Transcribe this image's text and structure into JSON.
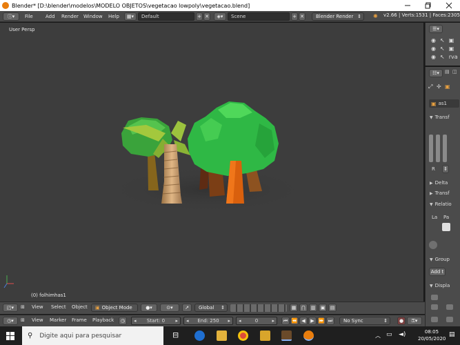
{
  "window": {
    "title": "Blender* [D:\\blender\\modelos\\MODELO OBJETOS\\vegetacao lowpoly\\vegetacao.blend]",
    "minimize_icon": "minimize-icon",
    "maximize_icon": "maximize-icon",
    "close_icon": "close-icon"
  },
  "info_header": {
    "menus": [
      "File",
      "Add",
      "Render",
      "Window",
      "Help"
    ],
    "screen_layout": "Default",
    "scene": "Scene",
    "render_engine": "Blender Render",
    "stats": "v2.66 | Verts:1531 | Faces:2305"
  },
  "viewport": {
    "view_label": "User Persp",
    "object_label": "(0) folhimhas1"
  },
  "outliner": {
    "partial_label": "rva"
  },
  "properties": {
    "object_field": "as1",
    "panels": [
      "Transf",
      "Delta",
      "Transf",
      "Relatio",
      "Group",
      "Displa"
    ],
    "relations_labels": [
      "La",
      "Pa"
    ],
    "r_label": "R",
    "add_button": "Add t"
  },
  "viewport_header": {
    "menus": [
      "View",
      "Select",
      "Object"
    ],
    "mode": "Object Mode",
    "orientation": "Global"
  },
  "timeline_header": {
    "menus": [
      "View",
      "Marker",
      "Frame",
      "Playback"
    ],
    "start": "Start: 0",
    "end": "End: 250",
    "current": "0",
    "sync": "No Sync"
  },
  "taskbar": {
    "search_placeholder": "Digite aqui para pesquisar",
    "time": "08:05",
    "date": "20/05/2020"
  }
}
